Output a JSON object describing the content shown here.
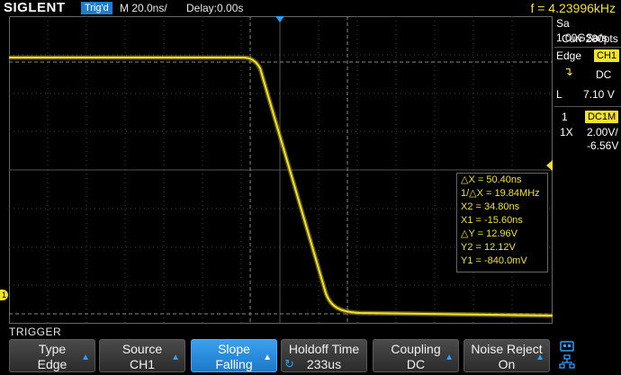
{
  "topbar": {
    "logo": "SIGLENT",
    "trigger_status": "Trig'd",
    "timebase": "M 20.0ns/",
    "delay": "Delay:0.00s",
    "frequency": "f = 4.23996kHz"
  },
  "acquisition": {
    "sample_rate": "Sa 1.00GSa/s",
    "memory": "Curr 280pts"
  },
  "trigger_panel": {
    "type": "Edge",
    "source": "CH1",
    "coupling": "DC",
    "level_prefix": "L",
    "level": "7.10 V"
  },
  "channel_panel": {
    "number": "1",
    "coupling": "DC1M",
    "probe": "1X",
    "scale": "2.00V/",
    "offset": "-6.56V"
  },
  "markers": {
    "ch1_ground": "1"
  },
  "cursors": {
    "dx": "△X = 50.40ns",
    "inv_dx": "1/△X = 19.84MHz",
    "x2": "X2 = 34.80ns",
    "x1": "X1 = -15.60ns",
    "dy": "△Y = 12.96V",
    "y2": "Y2 = 12.12V",
    "y1": "Y1 = -840.0mV"
  },
  "menu": {
    "title": "TRIGGER",
    "buttons": [
      {
        "label": "Type",
        "value": "Edge"
      },
      {
        "label": "Source",
        "value": "CH1"
      },
      {
        "label": "Slope",
        "value": "Falling"
      },
      {
        "label": "Holdoff Time",
        "value": "233us"
      },
      {
        "label": "Coupling",
        "value": "DC"
      },
      {
        "label": "Noise Reject",
        "value": "On"
      }
    ]
  },
  "colors": {
    "trace": "#f2e22c",
    "accent": "#1f7fcf",
    "grid": "#555555"
  }
}
